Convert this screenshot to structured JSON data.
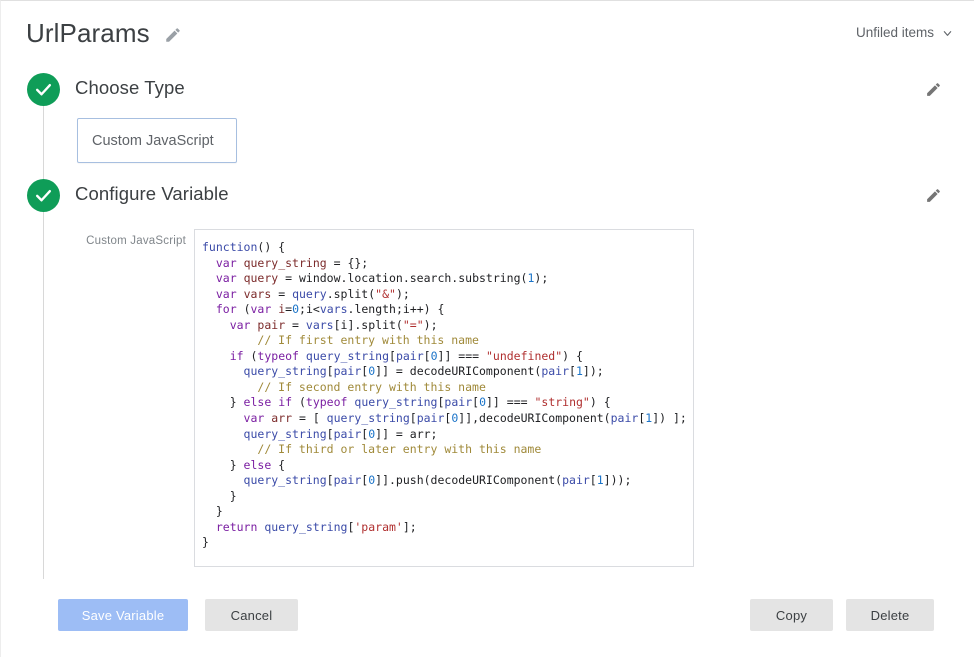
{
  "header": {
    "title": "UrlParams",
    "edit_icon": "pencil-icon",
    "folder_label": "Unfiled items",
    "chevron_icon": "chevron-down-icon"
  },
  "steps": [
    {
      "title": "Choose Type",
      "status_icon": "check-circle-icon",
      "edit_icon": "pencil-icon"
    },
    {
      "title": "Configure Variable",
      "status_icon": "check-circle-icon",
      "edit_icon": "pencil-icon"
    }
  ],
  "type_selector": {
    "value": "Custom JavaScript"
  },
  "configure": {
    "field_label": "Custom JavaScript",
    "code_lines": [
      [
        {
          "t": "function",
          "c": "fn"
        },
        {
          "t": "() {",
          "c": "plain"
        }
      ],
      [
        {
          "t": "  ",
          "c": "plain"
        },
        {
          "t": "var",
          "c": "kw"
        },
        {
          "t": " ",
          "c": "plain"
        },
        {
          "t": "query_string",
          "c": "idn"
        },
        {
          "t": " = {};",
          "c": "plain"
        }
      ],
      [
        {
          "t": "  ",
          "c": "plain"
        },
        {
          "t": "var",
          "c": "kw"
        },
        {
          "t": " ",
          "c": "plain"
        },
        {
          "t": "query",
          "c": "idn"
        },
        {
          "t": " = window.location.search.substring(",
          "c": "plain"
        },
        {
          "t": "1",
          "c": "num"
        },
        {
          "t": ");",
          "c": "plain"
        }
      ],
      [
        {
          "t": "  ",
          "c": "plain"
        },
        {
          "t": "var",
          "c": "kw"
        },
        {
          "t": " ",
          "c": "plain"
        },
        {
          "t": "vars",
          "c": "idn"
        },
        {
          "t": " = ",
          "c": "plain"
        },
        {
          "t": "query",
          "c": "prop"
        },
        {
          "t": ".split(",
          "c": "plain"
        },
        {
          "t": "\"&\"",
          "c": "str"
        },
        {
          "t": ");",
          "c": "plain"
        }
      ],
      [
        {
          "t": "  ",
          "c": "plain"
        },
        {
          "t": "for",
          "c": "kw"
        },
        {
          "t": " (",
          "c": "plain"
        },
        {
          "t": "var",
          "c": "kw"
        },
        {
          "t": " ",
          "c": "plain"
        },
        {
          "t": "i",
          "c": "idn"
        },
        {
          "t": "=",
          "c": "plain"
        },
        {
          "t": "0",
          "c": "num"
        },
        {
          "t": ";i<",
          "c": "plain"
        },
        {
          "t": "vars",
          "c": "prop"
        },
        {
          "t": ".length;i++) {",
          "c": "plain"
        }
      ],
      [
        {
          "t": "    ",
          "c": "plain"
        },
        {
          "t": "var",
          "c": "kw"
        },
        {
          "t": " ",
          "c": "plain"
        },
        {
          "t": "pair",
          "c": "idn"
        },
        {
          "t": " = ",
          "c": "plain"
        },
        {
          "t": "vars",
          "c": "prop"
        },
        {
          "t": "[i].split(",
          "c": "plain"
        },
        {
          "t": "\"=\"",
          "c": "str"
        },
        {
          "t": ");",
          "c": "plain"
        }
      ],
      [
        {
          "t": "        ",
          "c": "plain"
        },
        {
          "t": "// If first entry with this name",
          "c": "cmt"
        }
      ],
      [
        {
          "t": "    ",
          "c": "plain"
        },
        {
          "t": "if",
          "c": "kw"
        },
        {
          "t": " (",
          "c": "plain"
        },
        {
          "t": "typeof",
          "c": "kw"
        },
        {
          "t": " ",
          "c": "plain"
        },
        {
          "t": "query_string",
          "c": "prop"
        },
        {
          "t": "[",
          "c": "plain"
        },
        {
          "t": "pair",
          "c": "prop"
        },
        {
          "t": "[",
          "c": "plain"
        },
        {
          "t": "0",
          "c": "num"
        },
        {
          "t": "]] === ",
          "c": "plain"
        },
        {
          "t": "\"undefined\"",
          "c": "str"
        },
        {
          "t": ") {",
          "c": "plain"
        }
      ],
      [
        {
          "t": "      ",
          "c": "plain"
        },
        {
          "t": "query_string",
          "c": "prop"
        },
        {
          "t": "[",
          "c": "plain"
        },
        {
          "t": "pair",
          "c": "prop"
        },
        {
          "t": "[",
          "c": "plain"
        },
        {
          "t": "0",
          "c": "num"
        },
        {
          "t": "]] = decodeURIComponent(",
          "c": "plain"
        },
        {
          "t": "pair",
          "c": "prop"
        },
        {
          "t": "[",
          "c": "plain"
        },
        {
          "t": "1",
          "c": "num"
        },
        {
          "t": "]);",
          "c": "plain"
        }
      ],
      [
        {
          "t": "        ",
          "c": "plain"
        },
        {
          "t": "// If second entry with this name",
          "c": "cmt"
        }
      ],
      [
        {
          "t": "    } ",
          "c": "plain"
        },
        {
          "t": "else",
          "c": "kw"
        },
        {
          "t": " ",
          "c": "plain"
        },
        {
          "t": "if",
          "c": "kw"
        },
        {
          "t": " (",
          "c": "plain"
        },
        {
          "t": "typeof",
          "c": "kw"
        },
        {
          "t": " ",
          "c": "plain"
        },
        {
          "t": "query_string",
          "c": "prop"
        },
        {
          "t": "[",
          "c": "plain"
        },
        {
          "t": "pair",
          "c": "prop"
        },
        {
          "t": "[",
          "c": "plain"
        },
        {
          "t": "0",
          "c": "num"
        },
        {
          "t": "]] === ",
          "c": "plain"
        },
        {
          "t": "\"string\"",
          "c": "str"
        },
        {
          "t": ") {",
          "c": "plain"
        }
      ],
      [
        {
          "t": "      ",
          "c": "plain"
        },
        {
          "t": "var",
          "c": "kw"
        },
        {
          "t": " ",
          "c": "plain"
        },
        {
          "t": "arr",
          "c": "idn"
        },
        {
          "t": " = [ ",
          "c": "plain"
        },
        {
          "t": "query_string",
          "c": "prop"
        },
        {
          "t": "[",
          "c": "plain"
        },
        {
          "t": "pair",
          "c": "prop"
        },
        {
          "t": "[",
          "c": "plain"
        },
        {
          "t": "0",
          "c": "num"
        },
        {
          "t": "]],decodeURIComponent(",
          "c": "plain"
        },
        {
          "t": "pair",
          "c": "prop"
        },
        {
          "t": "[",
          "c": "plain"
        },
        {
          "t": "1",
          "c": "num"
        },
        {
          "t": "]) ];",
          "c": "plain"
        }
      ],
      [
        {
          "t": "      ",
          "c": "plain"
        },
        {
          "t": "query_string",
          "c": "prop"
        },
        {
          "t": "[",
          "c": "plain"
        },
        {
          "t": "pair",
          "c": "prop"
        },
        {
          "t": "[",
          "c": "plain"
        },
        {
          "t": "0",
          "c": "num"
        },
        {
          "t": "]] = arr;",
          "c": "plain"
        }
      ],
      [
        {
          "t": "        ",
          "c": "plain"
        },
        {
          "t": "// If third or later entry with this name",
          "c": "cmt"
        }
      ],
      [
        {
          "t": "    } ",
          "c": "plain"
        },
        {
          "t": "else",
          "c": "kw"
        },
        {
          "t": " {",
          "c": "plain"
        }
      ],
      [
        {
          "t": "      ",
          "c": "plain"
        },
        {
          "t": "query_string",
          "c": "prop"
        },
        {
          "t": "[",
          "c": "plain"
        },
        {
          "t": "pair",
          "c": "prop"
        },
        {
          "t": "[",
          "c": "plain"
        },
        {
          "t": "0",
          "c": "num"
        },
        {
          "t": "]].push(decodeURIComponent(",
          "c": "plain"
        },
        {
          "t": "pair",
          "c": "prop"
        },
        {
          "t": "[",
          "c": "plain"
        },
        {
          "t": "1",
          "c": "num"
        },
        {
          "t": "]));",
          "c": "plain"
        }
      ],
      [
        {
          "t": "    }",
          "c": "plain"
        }
      ],
      [
        {
          "t": "  }",
          "c": "plain"
        }
      ],
      [
        {
          "t": "  ",
          "c": "plain"
        },
        {
          "t": "return",
          "c": "kw"
        },
        {
          "t": " ",
          "c": "plain"
        },
        {
          "t": "query_string",
          "c": "prop"
        },
        {
          "t": "[",
          "c": "plain"
        },
        {
          "t": "'param'",
          "c": "str"
        },
        {
          "t": "];",
          "c": "plain"
        }
      ],
      [
        {
          "t": "}",
          "c": "plain"
        }
      ]
    ]
  },
  "footer": {
    "save_label": "Save Variable",
    "cancel_label": "Cancel",
    "copy_label": "Copy",
    "delete_label": "Delete"
  },
  "colors": {
    "accent_green": "#0f9d58",
    "primary_blue_disabled": "#9dbdf5",
    "button_gray": "#e4e4e4",
    "text": "#3c4043"
  }
}
